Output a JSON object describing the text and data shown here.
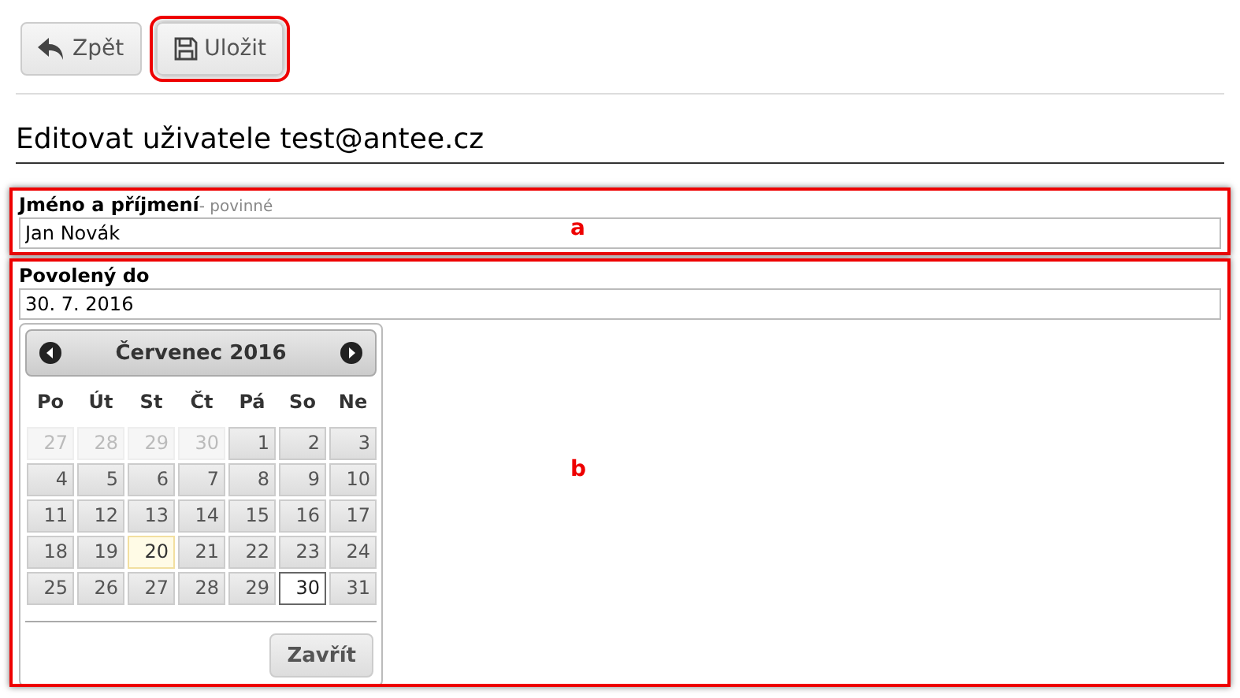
{
  "toolbar": {
    "buttons": [
      {
        "label": "Zpět",
        "kind": "back",
        "highlighted": false
      },
      {
        "label": "Uložit",
        "kind": "save",
        "highlighted": true
      }
    ]
  },
  "heading": "Editovat uživatele test@antee.cz",
  "fields": [
    {
      "label": "Jméno a příjmení",
      "hint": "- povinné",
      "value": "Jan Novák",
      "annotation": "a"
    },
    {
      "label": "Povolený do",
      "value": "30. 7. 2016",
      "annotation": "b"
    }
  ],
  "datepicker": {
    "month": "Červenec 2016",
    "weekdays": [
      "Po",
      "Út",
      "St",
      "Čt",
      "Pá",
      "So",
      "Ne"
    ],
    "weeks": [
      [
        {
          "day": "27",
          "muted": true,
          "today": false,
          "selected": false
        },
        {
          "day": "28",
          "muted": true,
          "today": false,
          "selected": false
        },
        {
          "day": "29",
          "muted": true,
          "today": false,
          "selected": false
        },
        {
          "day": "30",
          "muted": true,
          "today": false,
          "selected": false
        },
        {
          "day": "1",
          "muted": false,
          "today": false,
          "selected": false
        },
        {
          "day": "2",
          "muted": false,
          "today": false,
          "selected": false
        },
        {
          "day": "3",
          "muted": false,
          "today": false,
          "selected": false
        }
      ],
      [
        {
          "day": "4",
          "muted": false,
          "today": false,
          "selected": false
        },
        {
          "day": "5",
          "muted": false,
          "today": false,
          "selected": false
        },
        {
          "day": "6",
          "muted": false,
          "today": false,
          "selected": false
        },
        {
          "day": "7",
          "muted": false,
          "today": false,
          "selected": false
        },
        {
          "day": "8",
          "muted": false,
          "today": false,
          "selected": false
        },
        {
          "day": "9",
          "muted": false,
          "today": false,
          "selected": false
        },
        {
          "day": "10",
          "muted": false,
          "today": false,
          "selected": false
        }
      ],
      [
        {
          "day": "11",
          "muted": false,
          "today": false,
          "selected": false
        },
        {
          "day": "12",
          "muted": false,
          "today": false,
          "selected": false
        },
        {
          "day": "13",
          "muted": false,
          "today": false,
          "selected": false
        },
        {
          "day": "14",
          "muted": false,
          "today": false,
          "selected": false
        },
        {
          "day": "15",
          "muted": false,
          "today": false,
          "selected": false
        },
        {
          "day": "16",
          "muted": false,
          "today": false,
          "selected": false
        },
        {
          "day": "17",
          "muted": false,
          "today": false,
          "selected": false
        }
      ],
      [
        {
          "day": "18",
          "muted": false,
          "today": false,
          "selected": false
        },
        {
          "day": "19",
          "muted": false,
          "today": false,
          "selected": false
        },
        {
          "day": "20",
          "muted": false,
          "today": true,
          "selected": false
        },
        {
          "day": "21",
          "muted": false,
          "today": false,
          "selected": false
        },
        {
          "day": "22",
          "muted": false,
          "today": false,
          "selected": false
        },
        {
          "day": "23",
          "muted": false,
          "today": false,
          "selected": false
        },
        {
          "day": "24",
          "muted": false,
          "today": false,
          "selected": false
        }
      ],
      [
        {
          "day": "25",
          "muted": false,
          "today": false,
          "selected": false
        },
        {
          "day": "26",
          "muted": false,
          "today": false,
          "selected": false
        },
        {
          "day": "27",
          "muted": false,
          "today": false,
          "selected": false
        },
        {
          "day": "28",
          "muted": false,
          "today": false,
          "selected": false
        },
        {
          "day": "29",
          "muted": false,
          "today": false,
          "selected": false
        },
        {
          "day": "30",
          "muted": false,
          "today": false,
          "selected": true
        },
        {
          "day": "31",
          "muted": false,
          "today": false,
          "selected": false
        }
      ]
    ],
    "close": "Zavřít"
  }
}
